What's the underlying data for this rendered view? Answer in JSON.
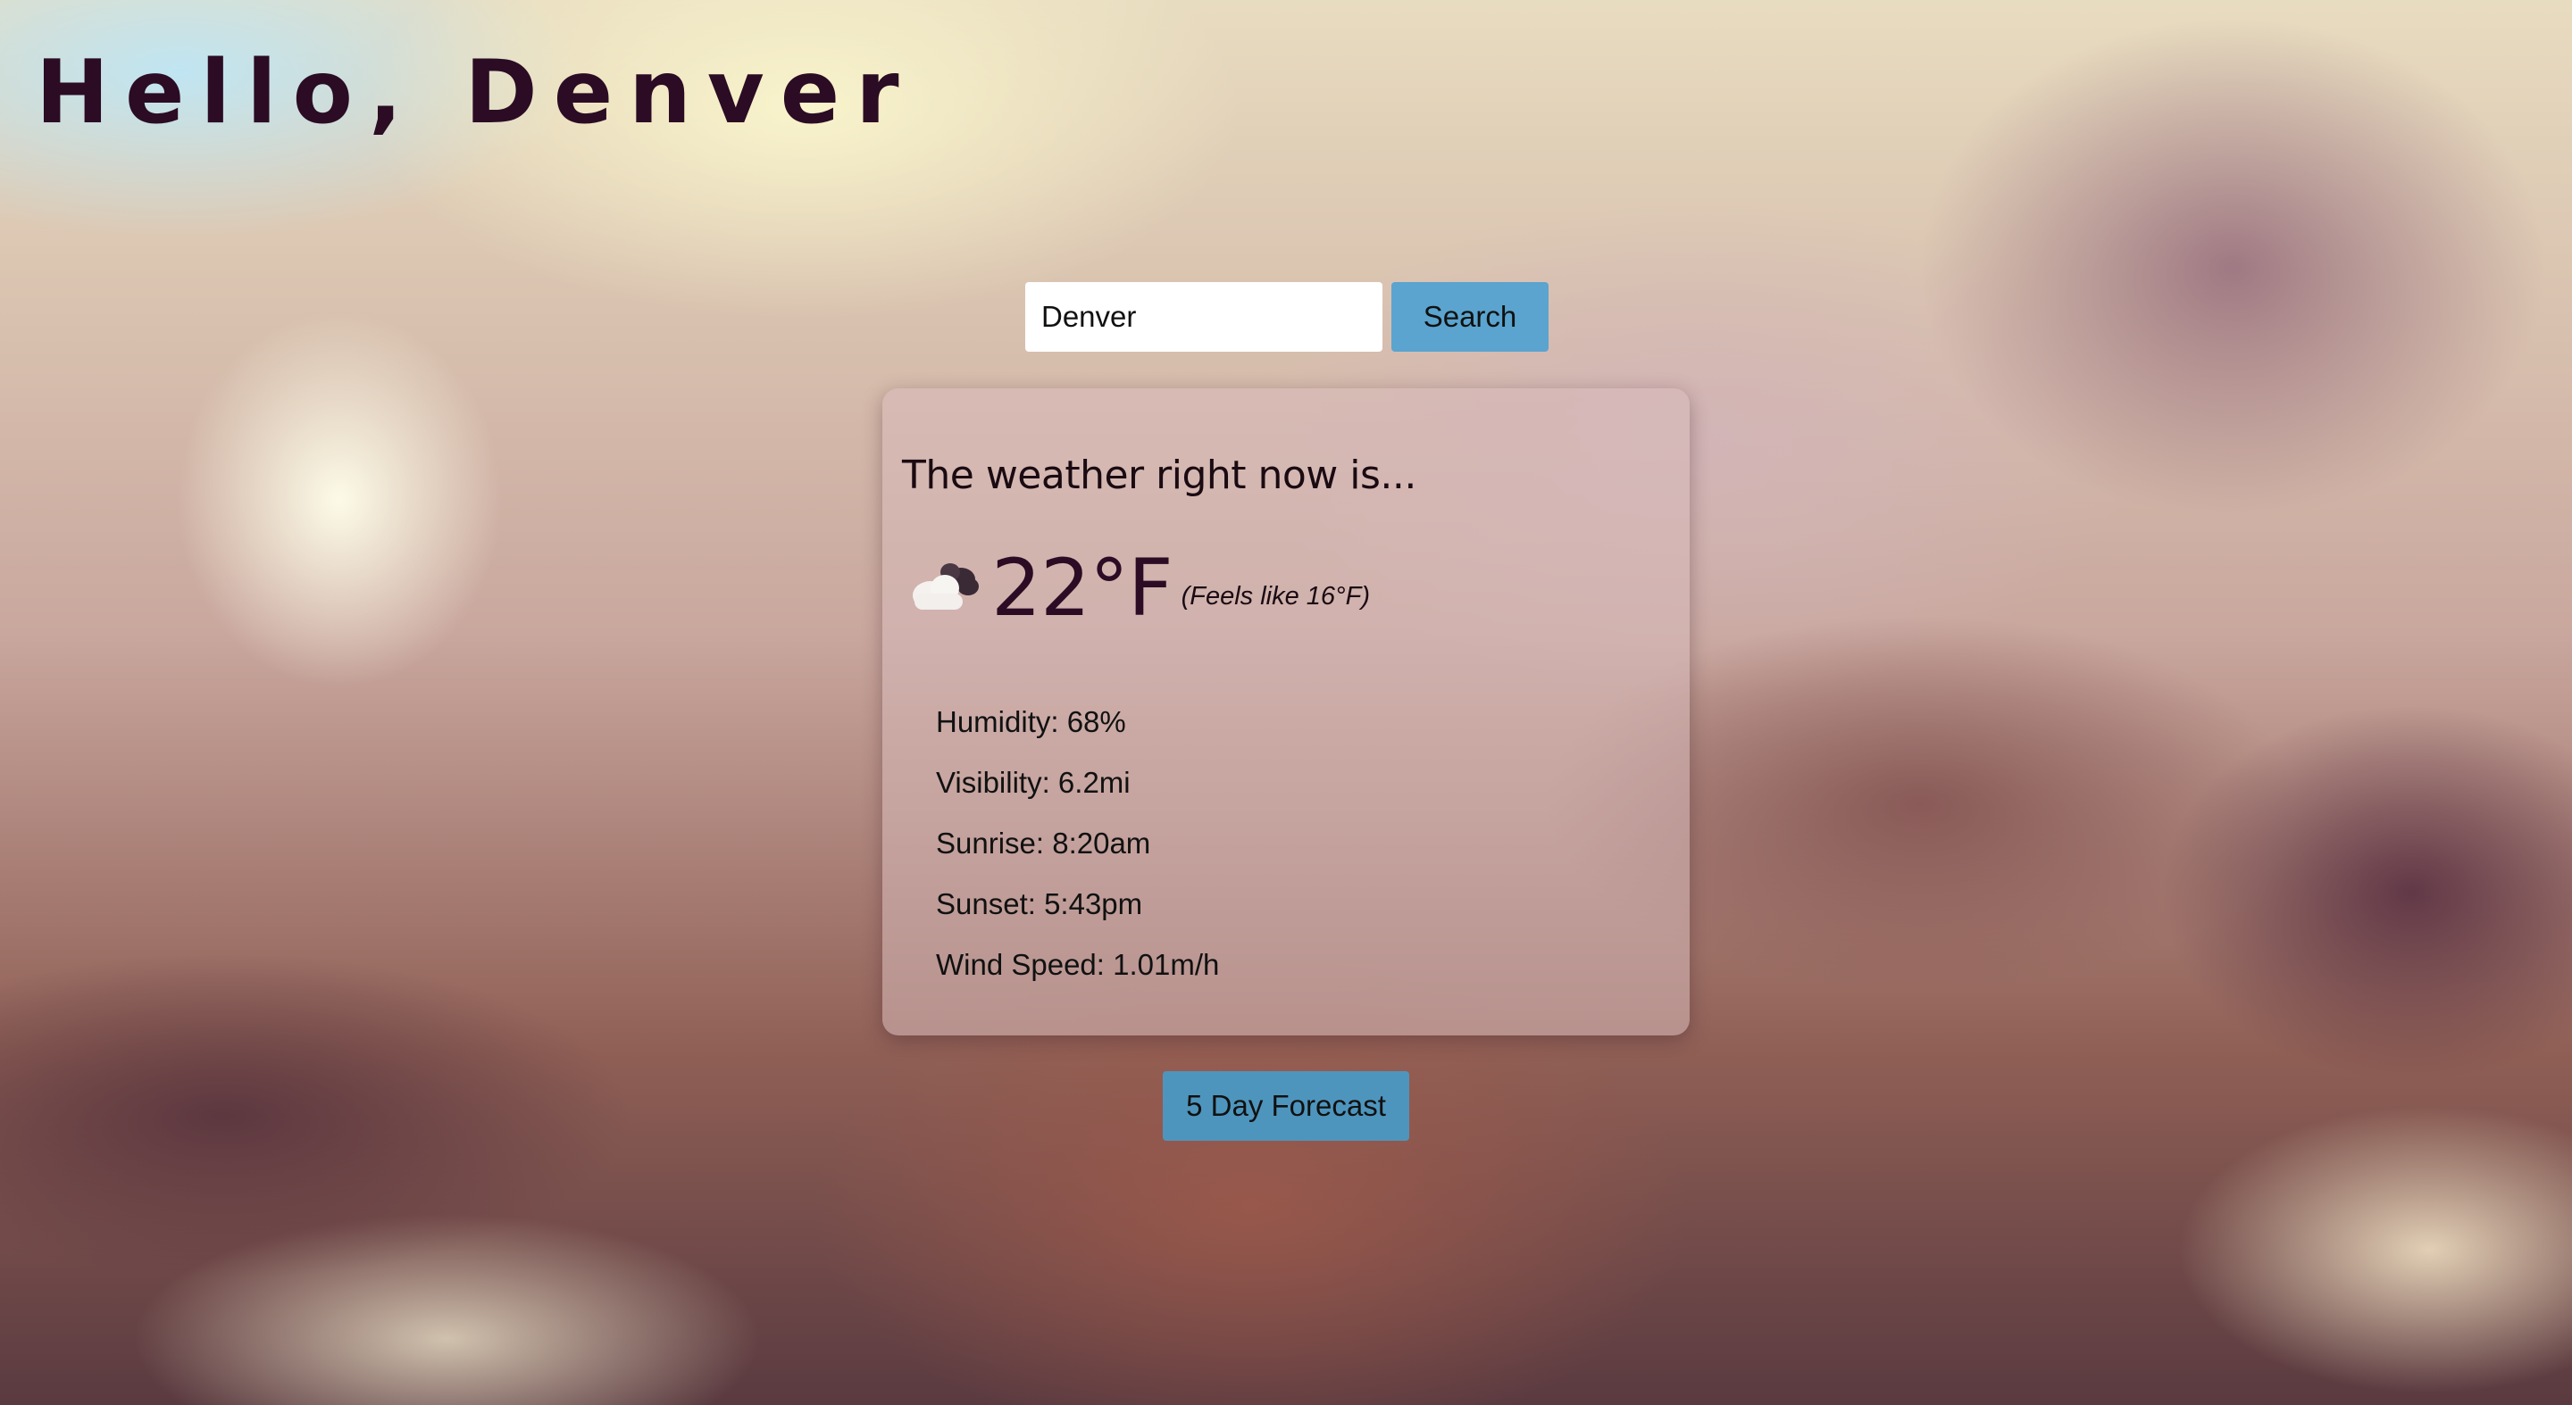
{
  "header": {
    "title": "Hello, Denver"
  },
  "search": {
    "value": "Denver",
    "placeholder": "",
    "button_label": "Search"
  },
  "weather": {
    "heading": "The weather right now is...",
    "icon": "cloud-icon",
    "temperature": "22°F",
    "feels_like": "(Feels like 16°F)",
    "details": [
      "Humidity: 68%",
      "Visibility: 6.2mi",
      "Sunrise: 8:20am",
      "Sunset: 5:43pm",
      "Wind Speed: 1.01m/h"
    ]
  },
  "forecast": {
    "button_label": "5 Day Forecast"
  },
  "colors": {
    "title_text": "#2b0c24",
    "search_button": "#5aa4cf",
    "forecast_button": "#4e95bd",
    "card_background": "rgba(215,185,185,0.55)"
  }
}
